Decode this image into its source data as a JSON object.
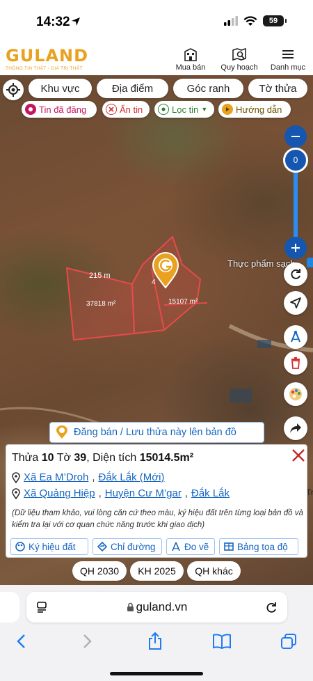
{
  "status_bar": {
    "time": "14:32",
    "battery": "59"
  },
  "header": {
    "logo": "GULAND",
    "tagline": "THÔNG TIN THẬT - GIÁ TRỊ THẬT",
    "nav": [
      {
        "label": "Mua bán",
        "icon": "building-icon"
      },
      {
        "label": "Quy hoạch",
        "icon": "map-search-icon"
      },
      {
        "label": "Danh mục",
        "icon": "menu-icon"
      }
    ]
  },
  "map": {
    "search_tabs": [
      "Khu vực",
      "Địa điểm",
      "Góc ranh",
      "Tờ thửa"
    ],
    "filters": [
      {
        "label": "Tin đã đăng",
        "color": "#c2185b",
        "icon": "post-icon"
      },
      {
        "label": "Ẩn tin",
        "color": "#d32f2f",
        "icon": "hide-icon"
      },
      {
        "label": "Lọc tin",
        "color": "#2e7d32",
        "icon": "filter-icon"
      },
      {
        "label": "Hướng dẫn",
        "color": "#8d6e00",
        "icon": "play-icon"
      }
    ],
    "zoom_level": "0",
    "poi_label": "Thực phẩm sạch",
    "road_label": "Tr",
    "parcel_labels": {
      "edge": "215 m",
      "area_left": "37818 m²",
      "area_right": "15107 m²",
      "under_marker": "4"
    },
    "post_banner": "Đăng bán / Lưu thửa này lên bản đồ",
    "accent": "#e8a21f",
    "parcel_color": "#e84a4a"
  },
  "info": {
    "title_prefix": "Thửa",
    "parcel_no": "10",
    "sheet_label": "Tờ",
    "sheet_no": "39",
    "area_label": ", Diện tích",
    "area_value": "15014.5m²",
    "addr_new": {
      "commune": "Xã Ea M’Droh",
      "province": "Đắk Lắk (Mới)"
    },
    "addr_old": {
      "commune": "Xã Quảng Hiệp",
      "district": "Huyện Cư M’gar",
      "province": "Đắk Lắk"
    },
    "note": "(Dữ liệu tham khảo, vui lòng căn cứ theo màu, ký hiệu đất trên từng loại bản đồ và kiểm tra lại với cơ quan chức năng trước khi giao dịch)",
    "actions": [
      {
        "label": "Ký hiệu đất",
        "icon": "palette-icon"
      },
      {
        "label": "Chỉ đường",
        "icon": "directions-icon"
      },
      {
        "label": "Đo vẽ",
        "icon": "measure-icon"
      },
      {
        "label": "Bảng tọa độ",
        "icon": "table-icon"
      }
    ]
  },
  "plans": [
    "QH 2030",
    "KH 2025",
    "QH khác"
  ],
  "browser": {
    "url": "guland.vn"
  }
}
